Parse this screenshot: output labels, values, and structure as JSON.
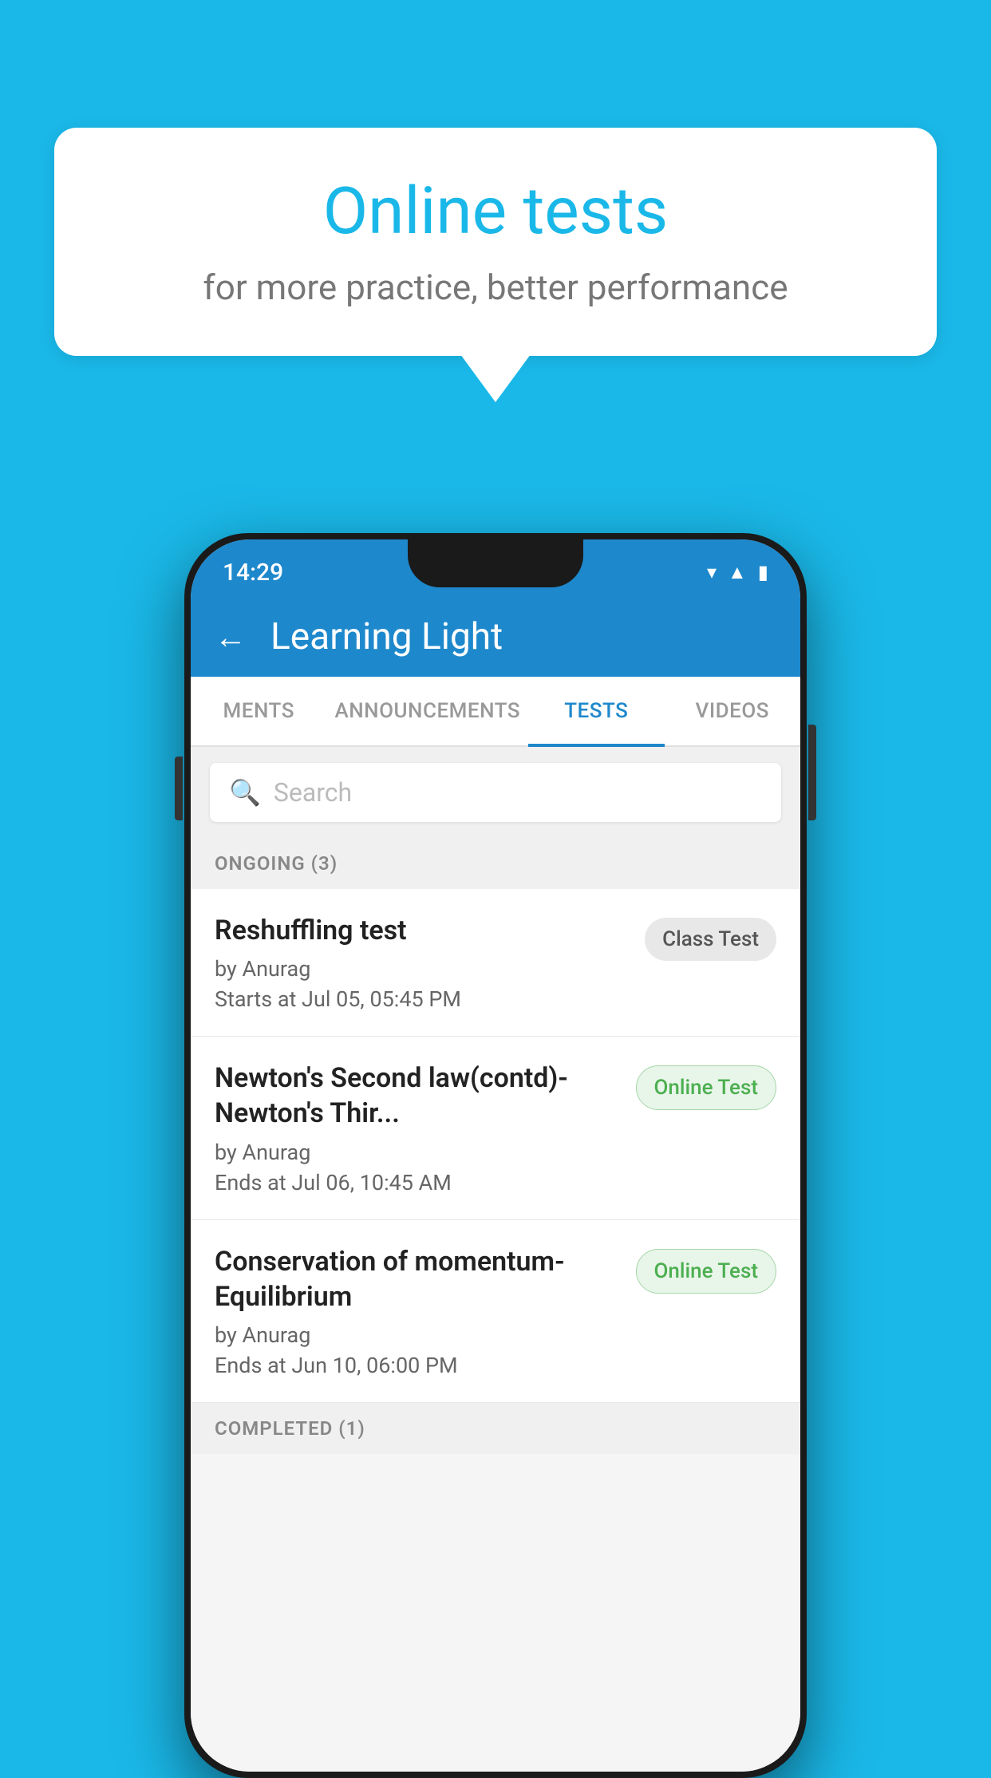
{
  "background_color": "#1ab8e8",
  "bubble": {
    "title": "Online tests",
    "subtitle": "for more practice, better performance"
  },
  "phone": {
    "status": {
      "time": "14:29",
      "icons": [
        "wifi",
        "signal",
        "battery"
      ]
    },
    "header": {
      "back_label": "←",
      "title": "Learning Light"
    },
    "tabs": [
      {
        "label": "MENTS",
        "active": false
      },
      {
        "label": "ANNOUNCEMENTS",
        "active": false
      },
      {
        "label": "TESTS",
        "active": true
      },
      {
        "label": "VIDEOS",
        "active": false
      }
    ],
    "search": {
      "placeholder": "Search",
      "icon": "🔍"
    },
    "sections": [
      {
        "label": "ONGOING (3)",
        "items": [
          {
            "title": "Reshuffling test",
            "author": "by Anurag",
            "time": "Starts at  Jul 05, 05:45 PM",
            "badge": "Class Test",
            "badge_type": "class"
          },
          {
            "title": "Newton's Second law(contd)-Newton's Thir...",
            "author": "by Anurag",
            "time": "Ends at  Jul 06, 10:45 AM",
            "badge": "Online Test",
            "badge_type": "online"
          },
          {
            "title": "Conservation of momentum-Equilibrium",
            "author": "by Anurag",
            "time": "Ends at  Jun 10, 06:00 PM",
            "badge": "Online Test",
            "badge_type": "online"
          }
        ]
      },
      {
        "label": "COMPLETED (1)",
        "items": []
      }
    ]
  }
}
